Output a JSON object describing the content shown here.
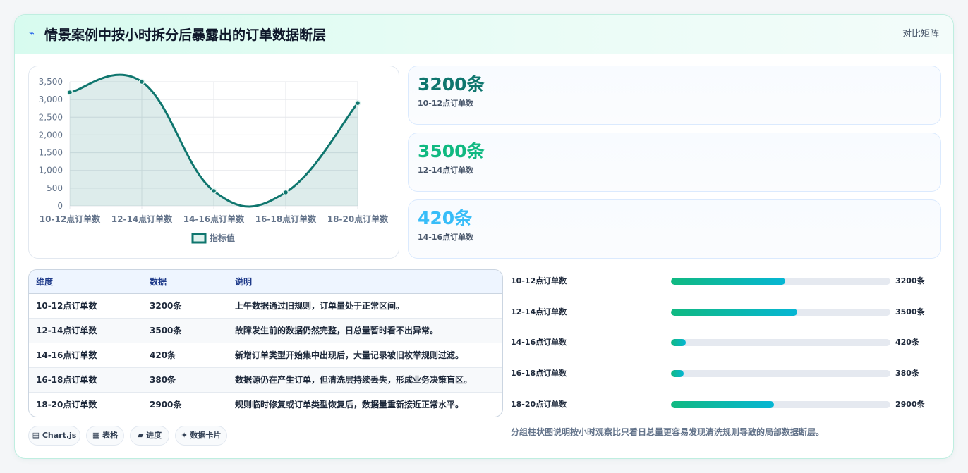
{
  "header": {
    "title": "情景案例中按小时拆分后暴露出的订单数据断层",
    "action": "对比矩阵",
    "icon": "lightning-icon"
  },
  "chart_data": {
    "type": "line",
    "categories": [
      "10-12点订单数",
      "12-14点订单数",
      "14-16点订单数",
      "16-18点订单数",
      "18-20点订单数"
    ],
    "series": [
      {
        "name": "指标值",
        "values": [
          3200,
          3500,
          420,
          380,
          2900
        ]
      }
    ],
    "ylim": [
      0,
      3500
    ],
    "yticks": [
      "3,500",
      "3,000",
      "2,500",
      "2,000",
      "1,500",
      "1,000",
      "500",
      "0"
    ],
    "grid": true,
    "legend": "bottom",
    "color": "#0f766e",
    "fill": "rgba(15,118,110,0.14)"
  },
  "stats": [
    {
      "value": "3200条",
      "label": "10-12点订单数",
      "color": "#0f766e"
    },
    {
      "value": "3500条",
      "label": "12-14点订单数",
      "color": "#10b981"
    },
    {
      "value": "420条",
      "label": "14-16点订单数",
      "color": "#38bdf8"
    }
  ],
  "table": {
    "headers": [
      "维度",
      "数据",
      "说明"
    ],
    "rows": [
      [
        "10-12点订单数",
        "3200条",
        "上午数据通过旧规则，订单量处于正常区间。"
      ],
      [
        "12-14点订单数",
        "3500条",
        "故障发生前的数据仍然完整，日总量暂时看不出异常。"
      ],
      [
        "14-16点订单数",
        "420条",
        "新增订单类型开始集中出现后，大量记录被旧枚举规则过滤。"
      ],
      [
        "16-18点订单数",
        "380条",
        "数据源仍在产生订单，但清洗层持续丢失，形成业务决策盲区。"
      ],
      [
        "18-20点订单数",
        "2900条",
        "规则临时修复或订单类型恢复后，数据量重新接近正常水平。"
      ]
    ]
  },
  "chips": [
    {
      "label": "▤ Chart.js",
      "icon": "chart-icon"
    },
    {
      "label": "▦ 表格",
      "icon": "table-icon"
    },
    {
      "label": "▰ 进度",
      "icon": "progress-icon"
    },
    {
      "label": "✦ 数据卡片",
      "icon": "sparkle-icon"
    }
  ],
  "progress": [
    {
      "label": "10-12点订单数",
      "value": "3200条",
      "fraction": 0.52
    },
    {
      "label": "12-14点订单数",
      "value": "3500条",
      "fraction": 0.576
    },
    {
      "label": "14-16点订单数",
      "value": "420条",
      "fraction": 0.068
    },
    {
      "label": "16-18点订单数",
      "value": "380条",
      "fraction": 0.058
    },
    {
      "label": "18-20点订单数",
      "value": "2900条",
      "fraction": 0.47
    }
  ],
  "note": "分组柱状图说明按小时观察比只看日总量更容易发现清洗规则导致的局部数据断层。"
}
